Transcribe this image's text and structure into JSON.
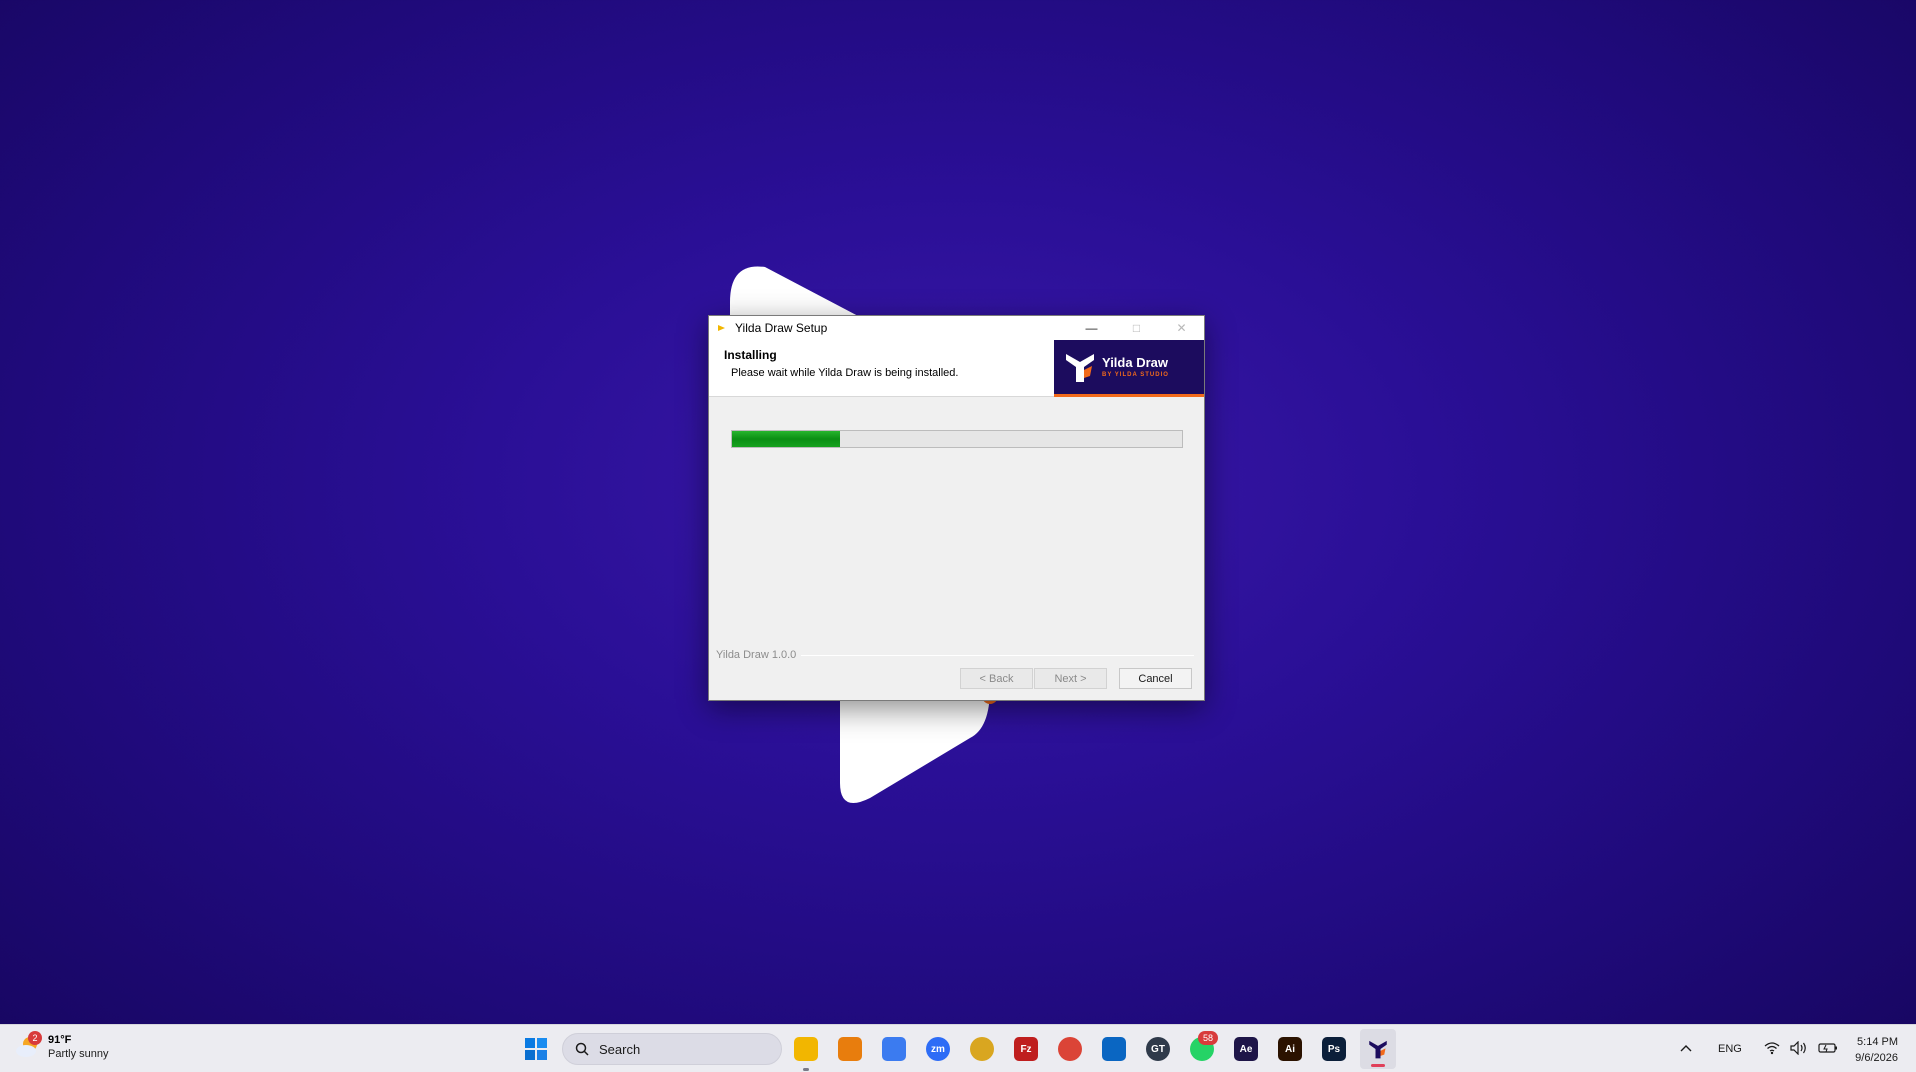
{
  "window": {
    "title": "Yilda Draw Setup",
    "minimize_glyph": "—",
    "maximize_glyph": "□",
    "close_glyph": "✕"
  },
  "header": {
    "title": "Installing",
    "subtitle": "Please wait while Yilda Draw is being installed.",
    "brand_name": "Yilda Draw",
    "brand_tagline": "BY YILDA STUDIO"
  },
  "progress": {
    "value_fraction": 0.24,
    "color": "#0b8f14"
  },
  "footer": {
    "version": "Yilda Draw 1.0.0",
    "back_label": "< Back",
    "next_label": "Next >",
    "cancel_label": "Cancel"
  },
  "taskbar": {
    "weather": {
      "temp": "91°F",
      "desc": "Partly sunny",
      "badge": "2"
    },
    "search_label": "Search",
    "apps": [
      {
        "name": "file-explorer-icon",
        "glyph": "",
        "color": "#f2b600"
      },
      {
        "name": "blender-icon",
        "glyph": "",
        "color": "#e87d0d"
      },
      {
        "name": "copilot-icon",
        "glyph": "",
        "color": "#3b7bf0"
      },
      {
        "name": "zoom-icon",
        "glyph": "zm",
        "color": "#2d6cf6"
      },
      {
        "name": "chrome-canary-icon",
        "glyph": "",
        "color": "#d9a620"
      },
      {
        "name": "filezilla-icon",
        "glyph": "Fz",
        "color": "#bf1e1e"
      },
      {
        "name": "chrome-icon",
        "glyph": "",
        "color": "#db4437"
      },
      {
        "name": "trello-icon",
        "glyph": "",
        "color": "#0a66c2"
      },
      {
        "name": "gt-icon",
        "glyph": "GT",
        "color": "#2f3a4a"
      },
      {
        "name": "whatsapp-icon",
        "glyph": "",
        "color": "#25d366"
      },
      {
        "name": "after-effects-icon",
        "glyph": "Ae",
        "color": "#1e1548"
      },
      {
        "name": "illustrator-icon",
        "glyph": "Ai",
        "color": "#2b1200"
      },
      {
        "name": "photoshop-icon",
        "glyph": "Ps",
        "color": "#0b1f3a"
      },
      {
        "name": "yilda-draw-icon",
        "glyph": "",
        "color": "#f26a1b"
      }
    ],
    "whatsapp_badge": "58",
    "language": "ENG",
    "time": "5:14 PM",
    "date": "9/6/2026"
  }
}
